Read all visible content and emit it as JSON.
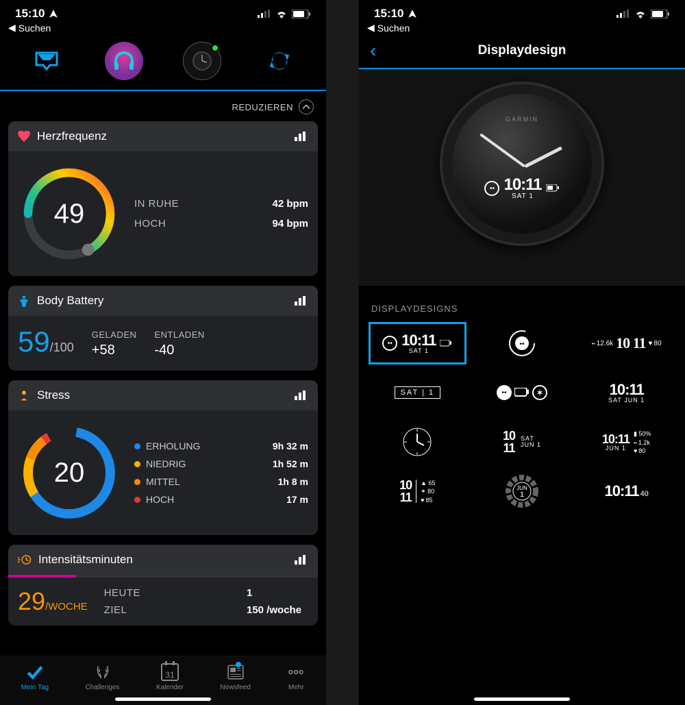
{
  "status": {
    "time": "15:10",
    "back_search": "Suchen"
  },
  "left": {
    "collapse_label": "REDUZIEREN",
    "cards": {
      "hr": {
        "title": "Herzfrequenz",
        "value": "49",
        "resting_label": "IN RUHE",
        "resting_value": "42 bpm",
        "high_label": "HOCH",
        "high_value": "94 bpm"
      },
      "body_battery": {
        "title": "Body Battery",
        "score": "59",
        "max": "/100",
        "charged_label": "GELADEN",
        "charged_value": "+58",
        "drained_label": "ENTLADEN",
        "drained_value": "-40"
      },
      "stress": {
        "title": "Stress",
        "value": "20",
        "legend": [
          {
            "color": "#1e88e5",
            "label": "ERHOLUNG",
            "value": "9h 32 m"
          },
          {
            "color": "#ffb300",
            "label": "NIEDRIG",
            "value": "1h 52 m"
          },
          {
            "color": "#fb8c00",
            "label": "MITTEL",
            "value": "1h 8 m"
          },
          {
            "color": "#e53935",
            "label": "HOCH",
            "value": "17 m"
          }
        ]
      },
      "intensity": {
        "title": "Intensitätsminuten",
        "value": "29",
        "unit": "/WOCHE",
        "today_label": "HEUTE",
        "today_value": "1",
        "goal_label": "ZIEL",
        "goal_value": "150 /woche"
      }
    },
    "bottom_nav": {
      "my_day": "Mein Tag",
      "challenges": "Challenges",
      "calendar": "Kalender",
      "calendar_day": "31",
      "newsfeed": "Newsfeed",
      "more": "Mehr"
    }
  },
  "right": {
    "title": "Displaydesign",
    "watch_brand": "GARMIN",
    "watch_time": "10:11",
    "watch_date": "SAT 1",
    "section_label": "DISPLAYDESIGNS",
    "faces": {
      "f1_time": "10:11",
      "f1_date": "SAT 1",
      "f3_steps": "12.6k",
      "f3_hr": "80",
      "f4_text": "SAT | 1",
      "f6_time": "10:11",
      "f6_date": "SAT JUN 1",
      "f8_a": "10",
      "f8_b": "11",
      "f8_day": "SAT",
      "f8_date": "JUN 1",
      "f9_time": "10:11",
      "f9_date": "JUN 1",
      "f9_bat": "50%",
      "f9_steps": "1.2k",
      "f9_hr": "80",
      "f10_a": "10",
      "f10_b": "11",
      "f10_v1": "65",
      "f10_v2": "80",
      "f10_v3": "85",
      "f11_month": "JUN",
      "f11_day": "1",
      "f12_time": "10:11",
      "f12_sec": "40"
    }
  },
  "chart_data": [
    {
      "type": "pie",
      "title": "Herzfrequenz gauge",
      "values": [
        49
      ],
      "ylim": [
        40,
        100
      ],
      "annotations": {
        "resting": 42,
        "high": 94
      }
    },
    {
      "type": "pie",
      "title": "Stress breakdown",
      "series": [
        {
          "name": "Erholung",
          "value_minutes": 572
        },
        {
          "name": "Niedrig",
          "value_minutes": 112
        },
        {
          "name": "Mittel",
          "value_minutes": 68
        },
        {
          "name": "Hoch",
          "value_minutes": 17
        }
      ],
      "center_value": 20
    }
  ]
}
